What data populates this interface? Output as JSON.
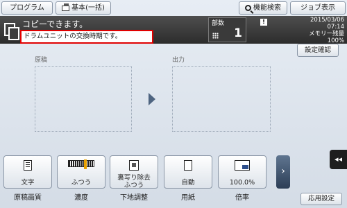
{
  "topbar": {
    "program_label": "プログラム",
    "basic_label": "基本(一括)",
    "search_label": "機能検索",
    "job_label": "ジョブ表示"
  },
  "status": {
    "main_message": "コピーできます。",
    "alert_message": "ドラムユニットの交換時期です。",
    "copies_label": "部数",
    "copies_value": "1",
    "alert_icon": "!",
    "date": "2015/03/06",
    "time": "07:14",
    "memory_label": "メモリー残量",
    "memory_value": "100%"
  },
  "settings_confirm_label": "設定確認",
  "preview": {
    "original_label": "原稿",
    "output_label": "出力"
  },
  "functions": [
    {
      "value": "文字",
      "label": "原稿画質",
      "icon": "document-icon"
    },
    {
      "value": "ふつう",
      "label": "濃度",
      "icon": "density-icon"
    },
    {
      "value": "裏写り除去\nふつう",
      "value_line1": "裏写り除去",
      "value_line2": "ふつう",
      "label": "下地調整",
      "icon": "background-icon"
    },
    {
      "value": "自動",
      "label": "用紙",
      "icon": "paper-icon"
    },
    {
      "value": "100.0%",
      "label": "倍率",
      "icon": "zoom-icon"
    }
  ],
  "next_label": "›",
  "side_tab_label": "◂◂",
  "apply_settings_label": "応用設定",
  "colors": {
    "status_bar": "#3c3c3c",
    "alert_border": "#e00000",
    "accent": "#4e6480"
  }
}
